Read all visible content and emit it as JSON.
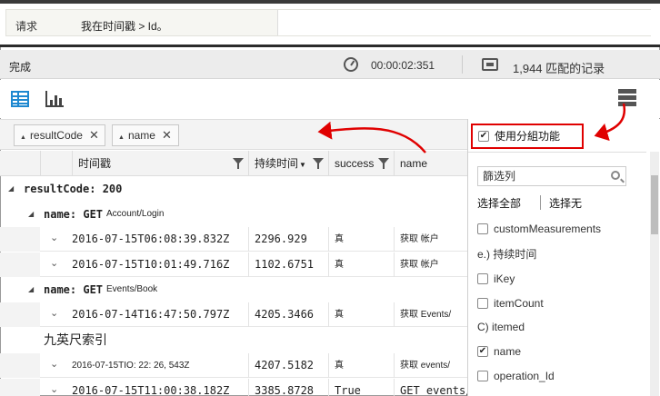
{
  "query": {
    "line_label": "请求",
    "text": "我在时间戳 > Id。"
  },
  "status": {
    "state": "完成",
    "icon": "timer-icon",
    "elapsed": "00:00:02:351",
    "records": "1,944 匹配的记录"
  },
  "toolbar": {
    "table_view_icon": "table-view-icon",
    "chart_view_icon": "chart-view-icon",
    "column_chooser_icon": "columns-icon"
  },
  "group_by": {
    "chips": [
      {
        "label": "resultCode"
      },
      {
        "label": "name"
      }
    ],
    "close_glyph": "✕"
  },
  "grid": {
    "columns": {
      "timestamp": "时间戳",
      "duration": "持续时间",
      "success": "success",
      "name": "name"
    },
    "groups": {
      "resultcode_label": "resultCode: 200",
      "sub1_key": "name: GET",
      "sub1_value": "Account/Login",
      "sub2_key": "name: GET",
      "sub2_value": "Events/Book",
      "sub3_label": "九英尺索引"
    },
    "rows": [
      {
        "timestamp": "2016-07-15T06:08:39.832Z",
        "duration": "2296.929",
        "success": "真",
        "name": "获取  帐户"
      },
      {
        "timestamp": "2016-07-15T10:01:49.716Z",
        "duration": "1102.6751",
        "success": "真",
        "name": "获取  帐户"
      },
      {
        "timestamp": "2016-07-14T16:47:50.797Z",
        "duration": "4205.3466",
        "success": "真",
        "name": "获取  Events/"
      },
      {
        "timestamp": "2016-07-15TIO: 22: 26, 543Z",
        "duration": "4207.5182",
        "success": "真",
        "name": "获取  events/"
      },
      {
        "timestamp": "2016-07-15T11:00:38.182Z",
        "duration": "3385.8728",
        "success": "True",
        "name": "GET events/"
      }
    ]
  },
  "column_panel": {
    "group_toggle_label": "使用分組功能",
    "group_toggle_checked": true,
    "filter_placeholder": "篩选列",
    "select_all": "选择全部",
    "select_none": "选择无",
    "items": [
      {
        "label": "customMeasurements",
        "type": "checkbox",
        "checked": false
      },
      {
        "label": "e.) 持续时间",
        "type": "header"
      },
      {
        "label": "iKey",
        "type": "checkbox",
        "checked": false
      },
      {
        "label": "itemCount",
        "type": "checkbox",
        "checked": false
      },
      {
        "label": "C) itemed",
        "type": "header"
      },
      {
        "label": "name",
        "type": "checkbox",
        "checked": true
      },
      {
        "label": "operation_Id",
        "type": "checkbox",
        "checked": false
      }
    ]
  },
  "colors": {
    "accent_blue": "#1e88d0",
    "callout_red": "#e00000"
  }
}
